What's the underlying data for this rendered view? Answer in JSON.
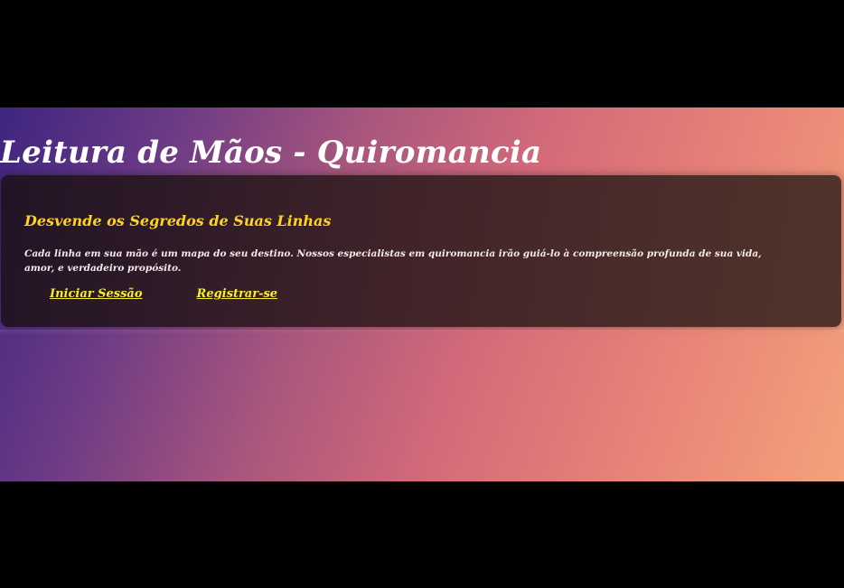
{
  "page": {
    "title": "Leitura de Mãos - Quiromancia"
  },
  "intro_card": {
    "heading": "Desvende os Segredos de Suas Linhas",
    "description": "Cada linha em sua mão é um mapa do seu destino. Nossos especialistas em quiromancia irão guiá-lo à compreensão profunda de sua vida, amor, e verdadeiro propósito.",
    "links": {
      "login_label": "Iniciar Sessão",
      "register_label": "Registrar-se"
    }
  },
  "colors": {
    "gradient_start": "#3e2580",
    "gradient_mid": "#d56b79",
    "gradient_end": "#f3a27c",
    "heading_color": "#ffd21f",
    "link_color": "#f7ef2e",
    "card_background": "#2a1a20"
  }
}
